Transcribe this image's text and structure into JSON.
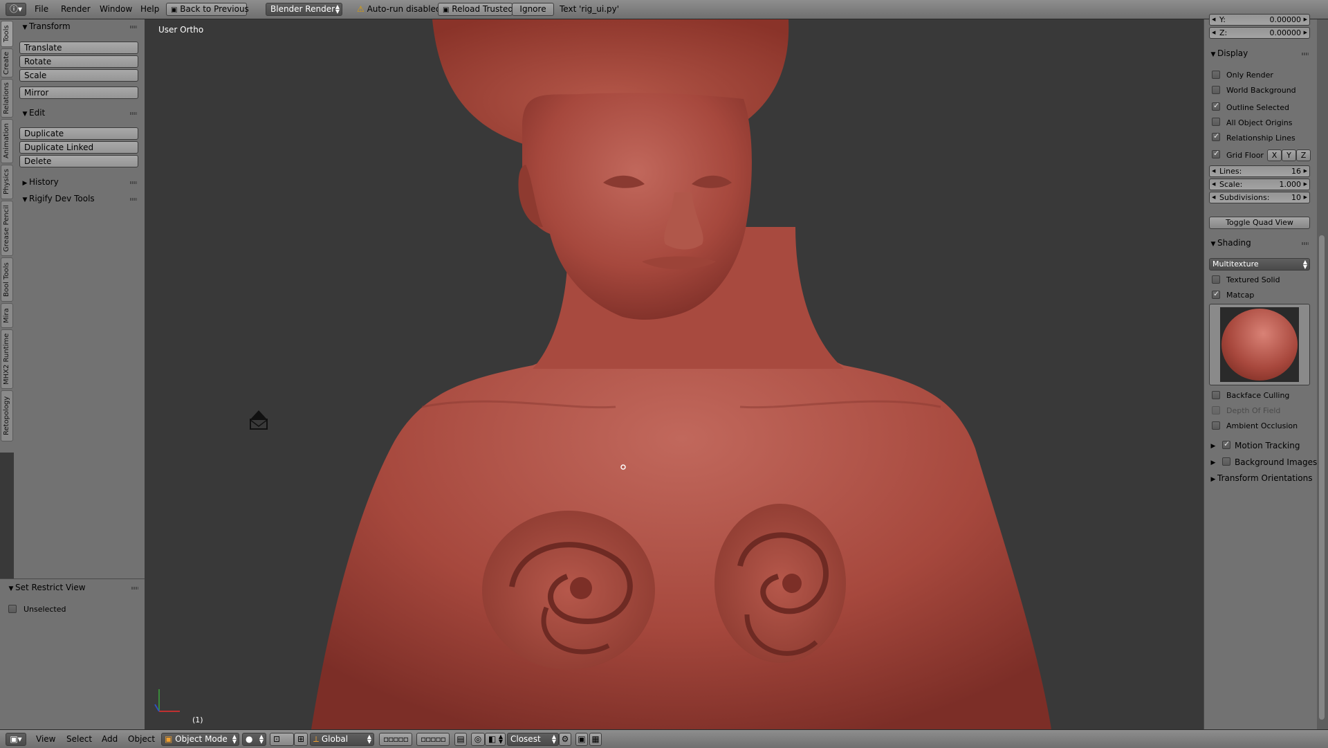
{
  "topbar": {
    "menus": [
      "File",
      "Render",
      "Window",
      "Help"
    ],
    "back_button": "Back to Previous",
    "render_engine": "Blender Render",
    "warning": "Auto-run disabled",
    "reload_button": "Reload Trusted",
    "ignore_button": "Ignore",
    "status_text": "Text 'rig_ui.py'"
  },
  "tool_tabs": [
    "Tools",
    "Create",
    "Relations",
    "Animation",
    "Physics",
    "Grease Pencil",
    "Bool Tools",
    "Mira",
    "MHX2 Runtime",
    "Retopology"
  ],
  "tools_panel": {
    "transform": {
      "title": "Transform",
      "buttons": [
        "Translate",
        "Rotate",
        "Scale",
        "Mirror"
      ]
    },
    "edit": {
      "title": "Edit",
      "buttons": [
        "Duplicate",
        "Duplicate Linked",
        "Delete"
      ]
    },
    "history": {
      "title": "History"
    },
    "rigify": {
      "title": "Rigify Dev Tools"
    }
  },
  "restrict_panel": {
    "title": "Set Restrict View",
    "checkbox": "Unselected"
  },
  "viewport": {
    "view_label": "User Ortho",
    "frame": "(1)"
  },
  "properties": {
    "y_field": {
      "label": "Y:",
      "value": "0.00000"
    },
    "z_field": {
      "label": "Z:",
      "value": "0.00000"
    },
    "display": {
      "title": "Display",
      "only_render": "Only Render",
      "world_background": "World Background",
      "outline_selected": "Outline Selected",
      "all_object_origins": "All Object Origins",
      "relationship_lines": "Relationship Lines",
      "grid_floor": "Grid Floor",
      "axes": [
        "X",
        "Y",
        "Z"
      ],
      "lines": {
        "label": "Lines:",
        "value": "16"
      },
      "scale": {
        "label": "Scale:",
        "value": "1.000"
      },
      "subdivisions": {
        "label": "Subdivisions:",
        "value": "10"
      },
      "toggle_quad": "Toggle Quad View"
    },
    "shading": {
      "title": "Shading",
      "mode": "Multitexture",
      "textured_solid": "Textured Solid",
      "matcap": "Matcap",
      "backface_culling": "Backface Culling",
      "depth_of_field": "Depth Of Field",
      "ambient_occlusion": "Ambient Occlusion"
    },
    "motion_tracking": "Motion Tracking",
    "background_images": "Background Images",
    "transform_orientations": "Transform Orientations"
  },
  "bottombar": {
    "menus": [
      "View",
      "Select",
      "Add",
      "Object"
    ],
    "mode": "Object Mode",
    "orientation": "Global",
    "snap": "Closest"
  },
  "colors": {
    "skin": "#a8483d",
    "viewport_bg": "#393939",
    "panel_bg": "#727272"
  }
}
